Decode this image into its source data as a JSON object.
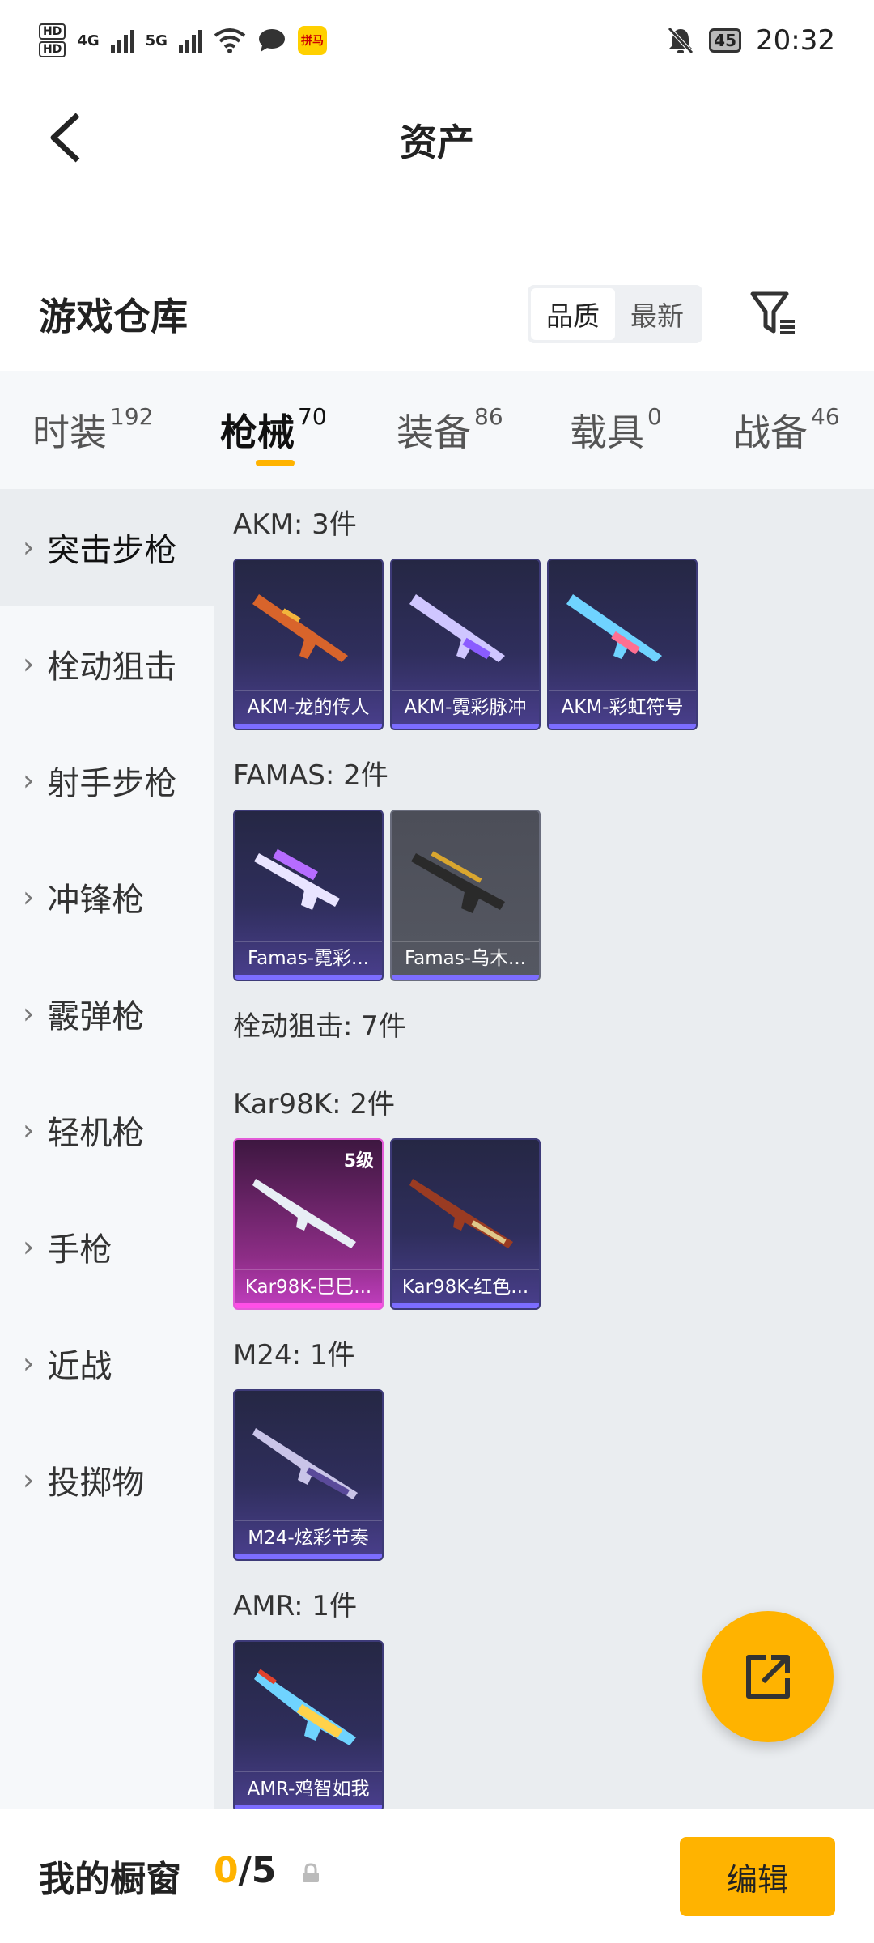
{
  "status_bar": {
    "hd1": "HD",
    "hd2": "HD",
    "net1": "4G",
    "net2": "5G",
    "app_badge": "拼马",
    "battery": "45",
    "time": "20:32"
  },
  "header": {
    "title": "资产"
  },
  "warehouse": {
    "title": "游戏仓库",
    "sort_options": [
      "品质",
      "最新"
    ],
    "sort_selected": "品质"
  },
  "tabs": [
    {
      "label": "时装",
      "count": "192"
    },
    {
      "label": "枪械",
      "count": "70"
    },
    {
      "label": "装备",
      "count": "86"
    },
    {
      "label": "载具",
      "count": "0"
    },
    {
      "label": "战备",
      "count": "46"
    }
  ],
  "active_tab": "枪械",
  "sidebar": {
    "items": [
      "突击步枪",
      "栓动狙击",
      "射手步枪",
      "冲锋枪",
      "霰弹枪",
      "轻机枪",
      "手枪",
      "近战",
      "投掷物"
    ],
    "active": "突击步枪"
  },
  "groups": [
    {
      "label": "AKM: 3件",
      "items": [
        "AKM-龙的传人",
        "AKM-霓彩脉冲",
        "AKM-彩虹符号"
      ]
    },
    {
      "label": "FAMAS: 2件",
      "items": [
        "Famas-霓彩...",
        "Famas-乌木..."
      ]
    },
    {
      "label": "栓动狙击: 7件",
      "items": []
    },
    {
      "label": "Kar98K: 2件",
      "items": [
        "Kar98K-巳巳...",
        "Kar98K-红色..."
      ],
      "level": "5级"
    },
    {
      "label": "M24: 1件",
      "items": [
        "M24-炫彩节奏"
      ]
    },
    {
      "label": "AMR: 1件",
      "items": [
        "AMR-鸡智如我"
      ]
    }
  ],
  "bottom_bar": {
    "label": "我的橱窗",
    "current": "0",
    "separator": "/",
    "max": "5",
    "edit_label": "编辑"
  },
  "colors": {
    "accent": "#ffb300",
    "card_purple": "#2f2e5c",
    "card_pink": "#c23ec0",
    "card_grey": "#555862"
  }
}
